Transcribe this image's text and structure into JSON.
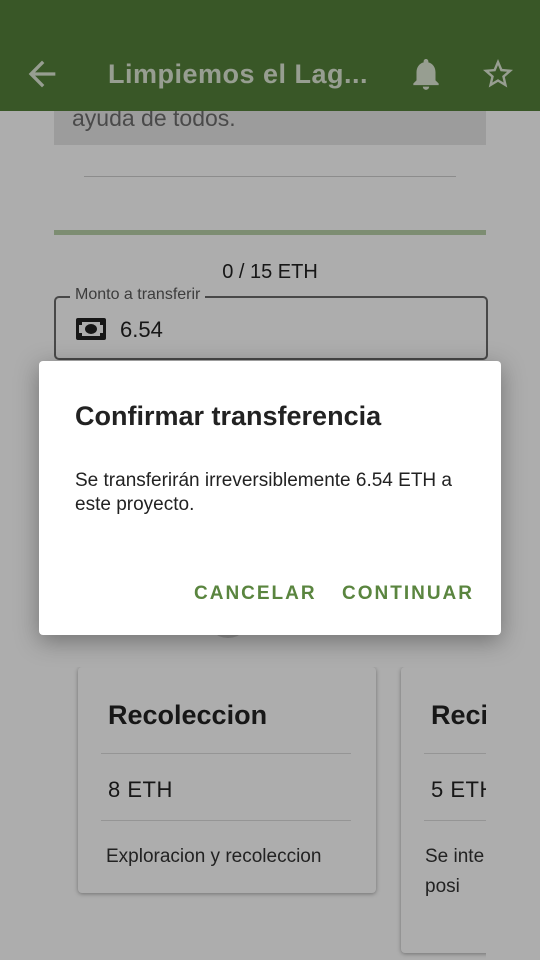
{
  "appbar": {
    "title": "Limpiemos el Lag...",
    "back_icon": "arrow-back-icon",
    "bell_icon": "bell-icon",
    "star_icon": "star-outline-icon",
    "color": "#55803a"
  },
  "project": {
    "description_tail": "ayuda de todos.",
    "progress_fraction": 0,
    "raised_text": "0 / 15 ETH",
    "amount_field": {
      "label": "Monto a transferir",
      "value": "6.54",
      "icon": "cash-icon"
    }
  },
  "cards": [
    {
      "title": "Recoleccion",
      "amount": "8 ETH",
      "description": "Exploracion y recoleccion"
    },
    {
      "title": "Reci",
      "amount": "5 ETH",
      "description": "Se inte basura lo posi"
    }
  ],
  "dialog": {
    "title": "Confirmar transferencia",
    "body": "Se transferirán irreversiblemente 6.54 ETH a este proyecto.",
    "cancel_label": "CANCELAR",
    "continue_label": "CONTINUAR",
    "accent": "#5a853f"
  }
}
